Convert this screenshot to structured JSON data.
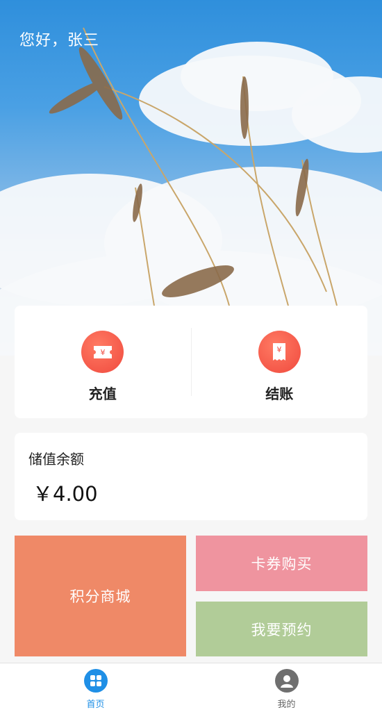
{
  "header": {
    "greeting": "您好，张三"
  },
  "actions": [
    {
      "label": "充值",
      "icon": "ticket-yen-icon"
    },
    {
      "label": "结账",
      "icon": "receipt-yen-icon"
    }
  ],
  "balance": {
    "title": "储值余额",
    "amount": "￥4.00"
  },
  "tiles": {
    "points_mall": "积分商城",
    "card_purchase": "卡券购买",
    "booking": "我要预约"
  },
  "tabbar": {
    "home": "首页",
    "mine": "我的",
    "active_color": "#1f8fe6",
    "inactive_color": "#666666"
  },
  "colors": {
    "points_tile": "#ef8967",
    "card_tile": "#ef949f",
    "booking_tile": "#b1cc98",
    "icon_red": "#f04a3e"
  }
}
